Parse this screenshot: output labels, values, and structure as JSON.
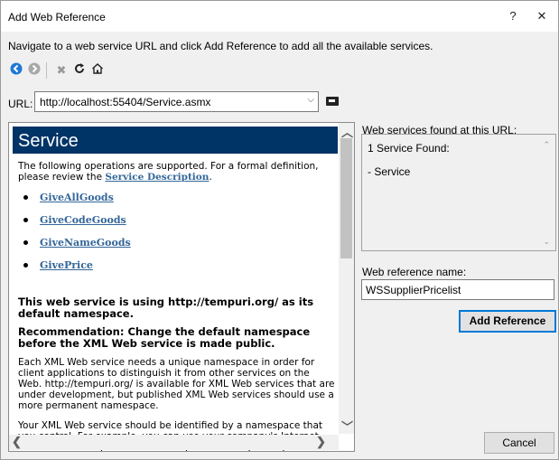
{
  "dialog": {
    "title": "Add Web Reference",
    "help_label": "?",
    "close_label": "✕",
    "instruction": "Navigate to a web service URL and click Add Reference to add all the available services."
  },
  "toolbar": {
    "back_icon": "back-circle-icon",
    "forward_icon": "forward-circle-icon",
    "stop_icon": "stop-icon",
    "refresh_icon": "refresh-icon",
    "home_icon": "home-icon"
  },
  "url": {
    "label": "URL:",
    "value": "http://localhost:55404/Service.asmx",
    "dropdown_glyph": "⌵"
  },
  "browser": {
    "service_title": "Service",
    "intro_text": "The following operations are supported. For a formal definition, please review the ",
    "intro_link": "Service Description",
    "intro_end": ".",
    "operations": [
      "GiveAllGoods",
      "GiveCodeGoods",
      "GiveNameGoods",
      "GivePrice"
    ],
    "heading1": "This web service is using http://tempuri.org/ as its default namespace.",
    "heading2": "Recommendation: Change the default namespace before the XML Web service is made public.",
    "para1": "Each XML Web service needs a unique namespace in order for client applications to distinguish it from other services on the Web. http://tempuri.org/ is available for XML Web services that are under development, but published XML Web services should use a more permanent namespace.",
    "para2": "Your XML Web service should be identified by a namespace that you control. For example, you can use your company's Internet domain name as part of the namespace. Although many XML Web service namespaces"
  },
  "right_panel": {
    "found_label": "Web services found at this URL:",
    "found_count": "1 Service Found:",
    "found_item": "- Service",
    "name_label": "Web reference name:",
    "name_value": "WSSupplierPricelist"
  },
  "buttons": {
    "add_reference": "Add Reference",
    "cancel": "Cancel"
  },
  "colors": {
    "service_header": "#003366",
    "link": "#336699",
    "default_button_border": "#0078d7"
  }
}
